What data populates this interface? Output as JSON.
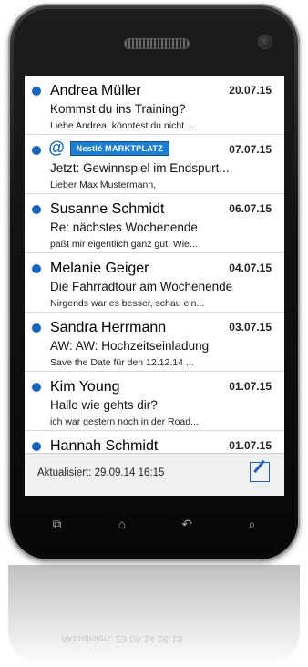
{
  "messages": [
    {
      "sender": "Andrea Müller",
      "date": "20.07.15",
      "subject": "Kommst du ins Training?",
      "preview": "Liebe Andrea, könntest du nicht ..."
    },
    {
      "sender": "",
      "date": "07.07.15",
      "subject": "Jetzt: Gewinnspiel im Endspurt...",
      "preview": "Lieber Max Mustermann,",
      "banner": "Nestlé MARKTPLATZ"
    },
    {
      "sender": "Susanne Schmidt",
      "date": "06.07.15",
      "subject": "Re: nächstes Wochenende",
      "preview": "paßt mir eigentlich ganz gut. Wie..."
    },
    {
      "sender": "Melanie Geiger",
      "date": "04.07.15",
      "subject": "Die Fahrradtour am Wochenende",
      "preview": "Nirgends war es besser, schau ein..."
    },
    {
      "sender": "Sandra Herrmann",
      "date": "03.07.15",
      "subject": "AW: AW: Hochzeitseinladung",
      "preview": "Save the Date für den 12.12.14 ..."
    },
    {
      "sender": "Kim Young",
      "date": "01.07.15",
      "subject": "Hallo wie gehts dir?",
      "preview": "ich war gestern noch in der Road..."
    },
    {
      "sender": "Hannah Schmidt",
      "date": "01.07.15",
      "subject": "",
      "preview": ""
    }
  ],
  "footer": {
    "updated": "Aktualisiert: 29.09.14 16:15"
  },
  "icons": {
    "unread": "unread-dot-icon",
    "compose": "compose-icon"
  },
  "nav": [
    "recent-apps-icon",
    "home-icon",
    "back-icon",
    "search-icon"
  ],
  "colors": {
    "accent": "#1565c0",
    "banner": "#1e7fd0"
  }
}
